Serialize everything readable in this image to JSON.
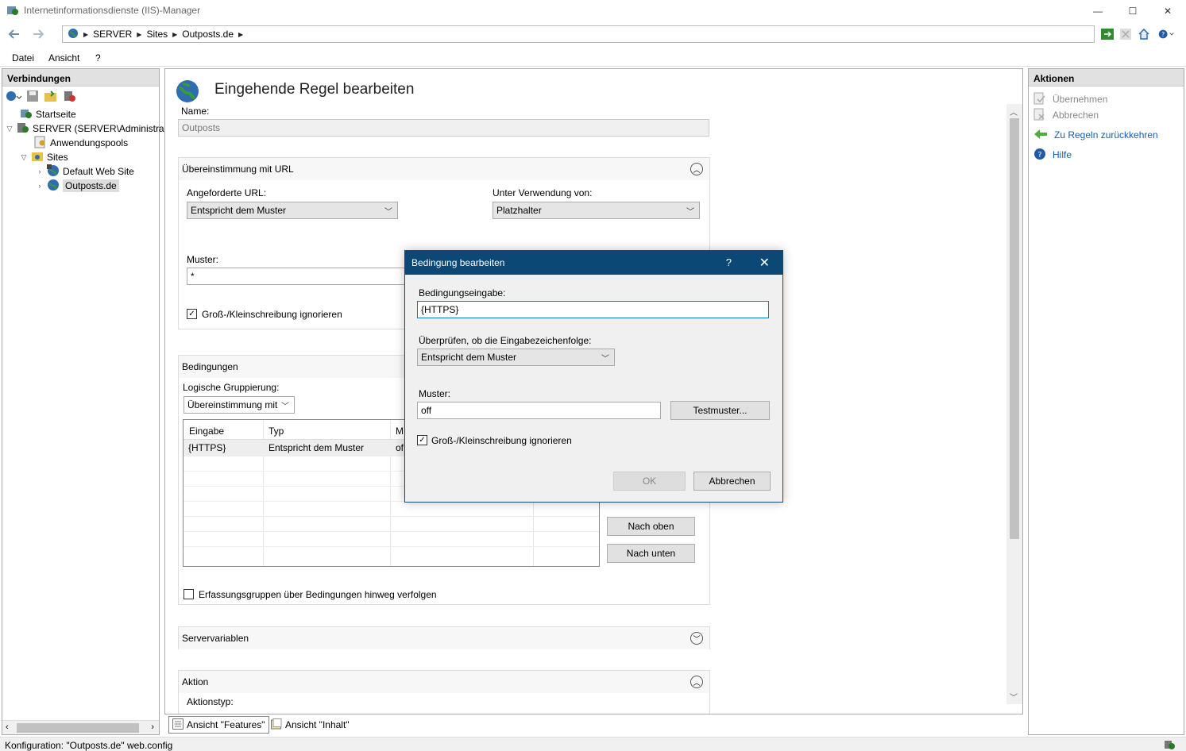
{
  "window": {
    "title": "Internetinformationsdienste (IIS)-Manager",
    "minimize": "—",
    "maximize": "☐",
    "close": "✕"
  },
  "address": {
    "crumbs": [
      "SERVER",
      "Sites",
      "Outposts.de"
    ],
    "separator": "▶"
  },
  "menu": {
    "items": [
      "Datei",
      "Ansicht",
      "?"
    ]
  },
  "connections": {
    "header": "Verbindungen",
    "tree": {
      "startseite": "Startseite",
      "server": "SERVER (SERVER\\Administrator)",
      "apppools": "Anwendungspools",
      "sites": "Sites",
      "default_site": "Default Web Site",
      "outposts": "Outposts.de"
    }
  },
  "main": {
    "title": "Eingehende Regel bearbeiten",
    "name_label": "Name:",
    "name_value": "Outposts",
    "url_section": {
      "title": "Übereinstimmung mit URL",
      "requested_url_label": "Angeforderte URL:",
      "requested_url_value": "Entspricht dem Muster",
      "using_label": "Unter Verwendung von:",
      "using_value": "Platzhalter",
      "pattern_label": "Muster:",
      "pattern_value": "*",
      "ignore_case_label": "Groß-/Kleinschreibung ignorieren",
      "ignore_case_checked": true
    },
    "conditions": {
      "title": "Bedingungen",
      "grouping_label": "Logische Gruppierung:",
      "grouping_value": "Übereinstimmung mit",
      "columns": [
        "Eingabe",
        "Typ",
        "M"
      ],
      "rows": [
        {
          "input": "{HTTPS}",
          "type": "Entspricht dem Muster",
          "pattern": "of"
        }
      ],
      "move_up": "Nach oben",
      "move_down": "Nach unten",
      "track_groups_label": "Erfassungsgruppen über Bedingungen hinweg verfolgen",
      "track_groups_checked": false
    },
    "server_vars": {
      "title": "Servervariablen"
    },
    "action": {
      "title": "Aktion",
      "type_label": "Aktionstyp:"
    }
  },
  "view_tabs": {
    "features": "Ansicht \"Features\"",
    "content": "Ansicht \"Inhalt\""
  },
  "actions": {
    "header": "Aktionen",
    "apply": "Übernehmen",
    "cancel": "Abbrechen",
    "back": "Zu Regeln zurückkehren",
    "help": "Hilfe"
  },
  "status": {
    "text": "Konfiguration: \"Outposts.de\" web.config"
  },
  "dialog": {
    "title": "Bedingung bearbeiten",
    "help": "?",
    "close": "✕",
    "input_label": "Bedingungseingabe:",
    "input_value": "{HTTPS}",
    "check_label": "Überprüfen, ob die Eingabezeichenfolge:",
    "check_value": "Entspricht dem Muster",
    "pattern_label": "Muster:",
    "pattern_value": "off",
    "test_button": "Testmuster...",
    "ignore_case_label": "Groß-/Kleinschreibung ignorieren",
    "ignore_case_checked": true,
    "ok": "OK",
    "cancel": "Abbrechen"
  },
  "colors": {
    "dialog_title_bg": "#0b4876",
    "link": "#1a5fa8"
  }
}
